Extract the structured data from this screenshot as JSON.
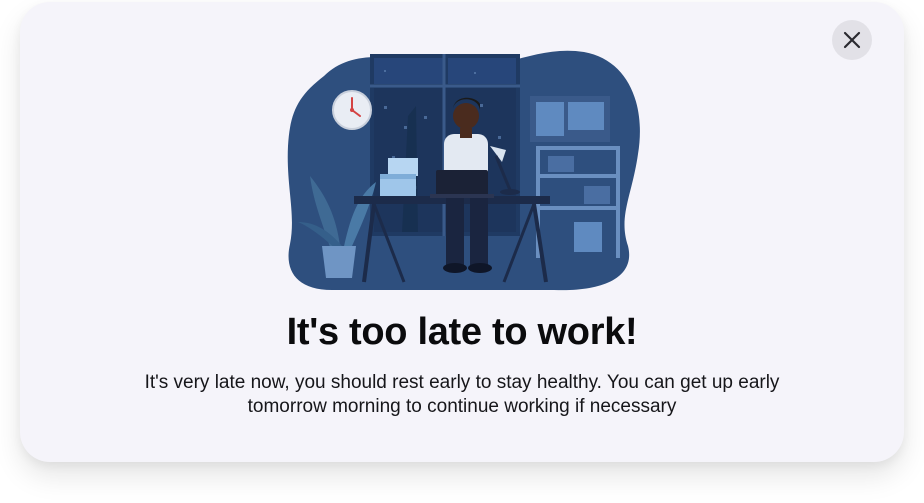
{
  "dialog": {
    "title": "It's too late to work!",
    "message": "It's very late now, you should rest early to stay healthy. You can get up early tomorrow morning to continue working if necessary",
    "close_icon": "close-icon",
    "illustration": "man-working-late-at-night-illustration"
  },
  "colors": {
    "dialog_bg": "#f5f4fa",
    "close_bg": "#e2e1e7",
    "blob": "#2e4f7e",
    "title_text": "#0b0b0d"
  }
}
